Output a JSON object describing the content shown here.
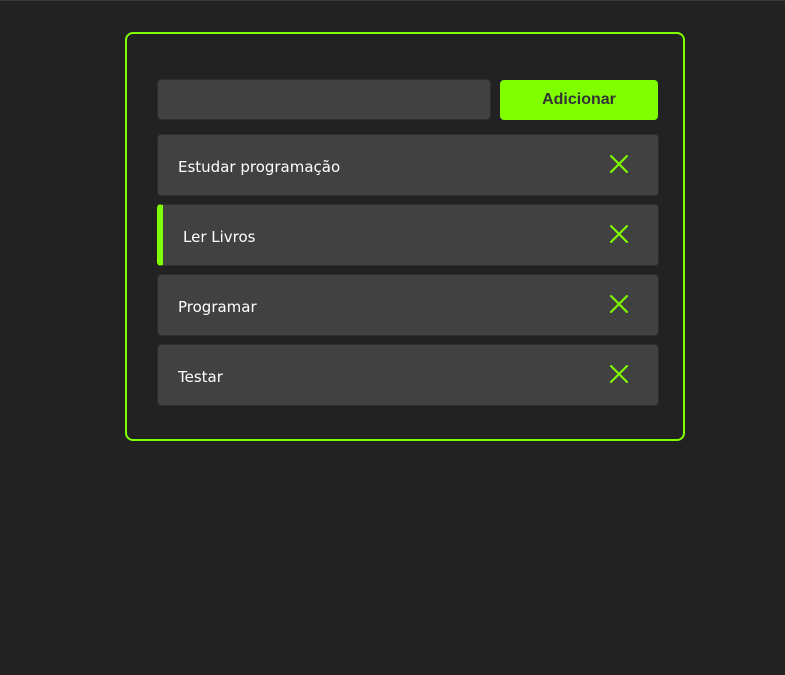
{
  "form": {
    "input_value": "",
    "input_placeholder": "",
    "add_label": "Adicionar"
  },
  "tasks": [
    {
      "label": "Estudar programação",
      "active": false
    },
    {
      "label": "Ler Livros",
      "active": true
    },
    {
      "label": "Programar",
      "active": false
    },
    {
      "label": "Testar",
      "active": false
    }
  ],
  "icons": {
    "delete": "close-icon"
  },
  "colors": {
    "background": "#222222",
    "accent": "#7fff00",
    "surface": "#414141",
    "text": "#ffffff"
  }
}
